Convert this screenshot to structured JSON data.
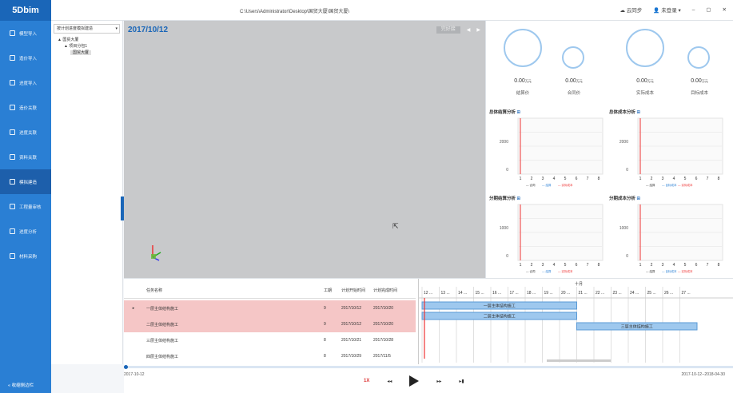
{
  "app": {
    "logo": "5Dbim",
    "path": "C:\\Users\\Administrator\\Desktop\\国贸大厦\\国贸大厦\\",
    "sync": "云同步",
    "login": "未登录",
    "min": "–",
    "max": "▢",
    "close": "✕"
  },
  "sidebar": {
    "items": [
      {
        "label": "模型导入"
      },
      {
        "label": "造价导入"
      },
      {
        "label": "进度导入"
      },
      {
        "label": "造价关联"
      },
      {
        "label": "进度关联"
      },
      {
        "label": "资料关联"
      },
      {
        "label": "模拟建造"
      },
      {
        "label": "工程量审核"
      },
      {
        "label": "进度分析"
      },
      {
        "label": "材料采购"
      }
    ],
    "active_index": 6,
    "bottom": "收缩侧边栏"
  },
  "tree": {
    "select": "按计划进度模拟建造",
    "nodes": [
      {
        "label": "国贸大厦",
        "indent": 1,
        "toggle": "▲"
      },
      {
        "label": "项目分包1",
        "indent": 2,
        "toggle": "▲"
      },
      {
        "label": "国贸大厦",
        "indent": 3,
        "toggle": ""
      }
    ]
  },
  "viewport": {
    "date": "2017/10/12",
    "slot": "完好接",
    "prev": "◀",
    "next": "▶"
  },
  "circles": [
    {
      "value": "0.00",
      "unit": "万元",
      "label": "结算价"
    },
    {
      "value": "0.00",
      "unit": "万元",
      "label": "合同价"
    },
    {
      "value": "0.00",
      "unit": "万元",
      "label": "实际成本"
    },
    {
      "value": "0.00",
      "unit": "万元",
      "label": "目标成本"
    }
  ],
  "charts": [
    {
      "title": "总体结算分析",
      "yticks": [
        "2000",
        "0"
      ],
      "legend": [
        "— 合同",
        "— 结算",
        "— 实际成本"
      ],
      "x": [
        "1",
        "2",
        "3",
        "4",
        "5",
        "6",
        "7",
        "8"
      ]
    },
    {
      "title": "总体成本分析",
      "yticks": [
        "2000",
        "0"
      ],
      "legend": [
        "— 结算",
        "— 目标成本",
        "— 实际成本"
      ],
      "x": [
        "1",
        "2",
        "3",
        "4",
        "5",
        "6",
        "7",
        "8"
      ]
    },
    {
      "title": "分期结算分析",
      "yticks": [
        "1000",
        "0"
      ],
      "legend": [
        "— 合同",
        "— 结算",
        "— 实际成本"
      ],
      "x": [
        "1",
        "2",
        "3",
        "4",
        "5",
        "6",
        "7",
        "8"
      ]
    },
    {
      "title": "分期成本分析",
      "yticks": [
        "1000",
        "0"
      ],
      "legend": [
        "— 结算",
        "— 目标成本",
        "— 实际成本"
      ],
      "x": [
        "1",
        "2",
        "3",
        "4",
        "5",
        "6",
        "7",
        "8"
      ]
    }
  ],
  "tasks": {
    "headers": [
      "任务名称",
      "工期",
      "计划开始时间",
      "计划完成时间"
    ],
    "rows": [
      {
        "marker": "▸",
        "name": "一层主体结构施工",
        "dur": "9",
        "start": "2017/10/12",
        "end": "2017/10/20",
        "pink": true
      },
      {
        "marker": "",
        "name": "二层主体结构施工",
        "dur": "9",
        "start": "2017/10/12",
        "end": "2017/10/20",
        "pink": true
      },
      {
        "marker": "",
        "name": "三层主体结构施工",
        "dur": "8",
        "start": "2017/10/21",
        "end": "2017/10/28",
        "pink": false
      },
      {
        "marker": "",
        "name": "四层主体结构施工",
        "dur": "8",
        "start": "2017/10/29",
        "end": "2017/11/5",
        "pink": false
      }
    ]
  },
  "gantt": {
    "month": "十月",
    "days": [
      "12 ...",
      "13 ...",
      "14 ...",
      "15 ...",
      "16 ...",
      "17 ...",
      "18 ...",
      "19 ...",
      "20 ...",
      "21 ...",
      "22 ...",
      "23 ...",
      "24 ...",
      "25 ...",
      "26 ...",
      "27 ..."
    ],
    "bars": [
      {
        "label": "一层主体结构施工",
        "from": 0,
        "to": 9
      },
      {
        "label": "二层主体结构施工",
        "from": 0,
        "to": 9
      },
      {
        "label": "三层主体结构施工",
        "from": 9,
        "to": 16
      }
    ]
  },
  "timeline": {
    "start": "2017-10-12",
    "range": "2017-10-12--2018-04-30",
    "speed": "1X",
    "rew": "◂◂",
    "ff": "▸▸",
    "end": "▸▮"
  }
}
